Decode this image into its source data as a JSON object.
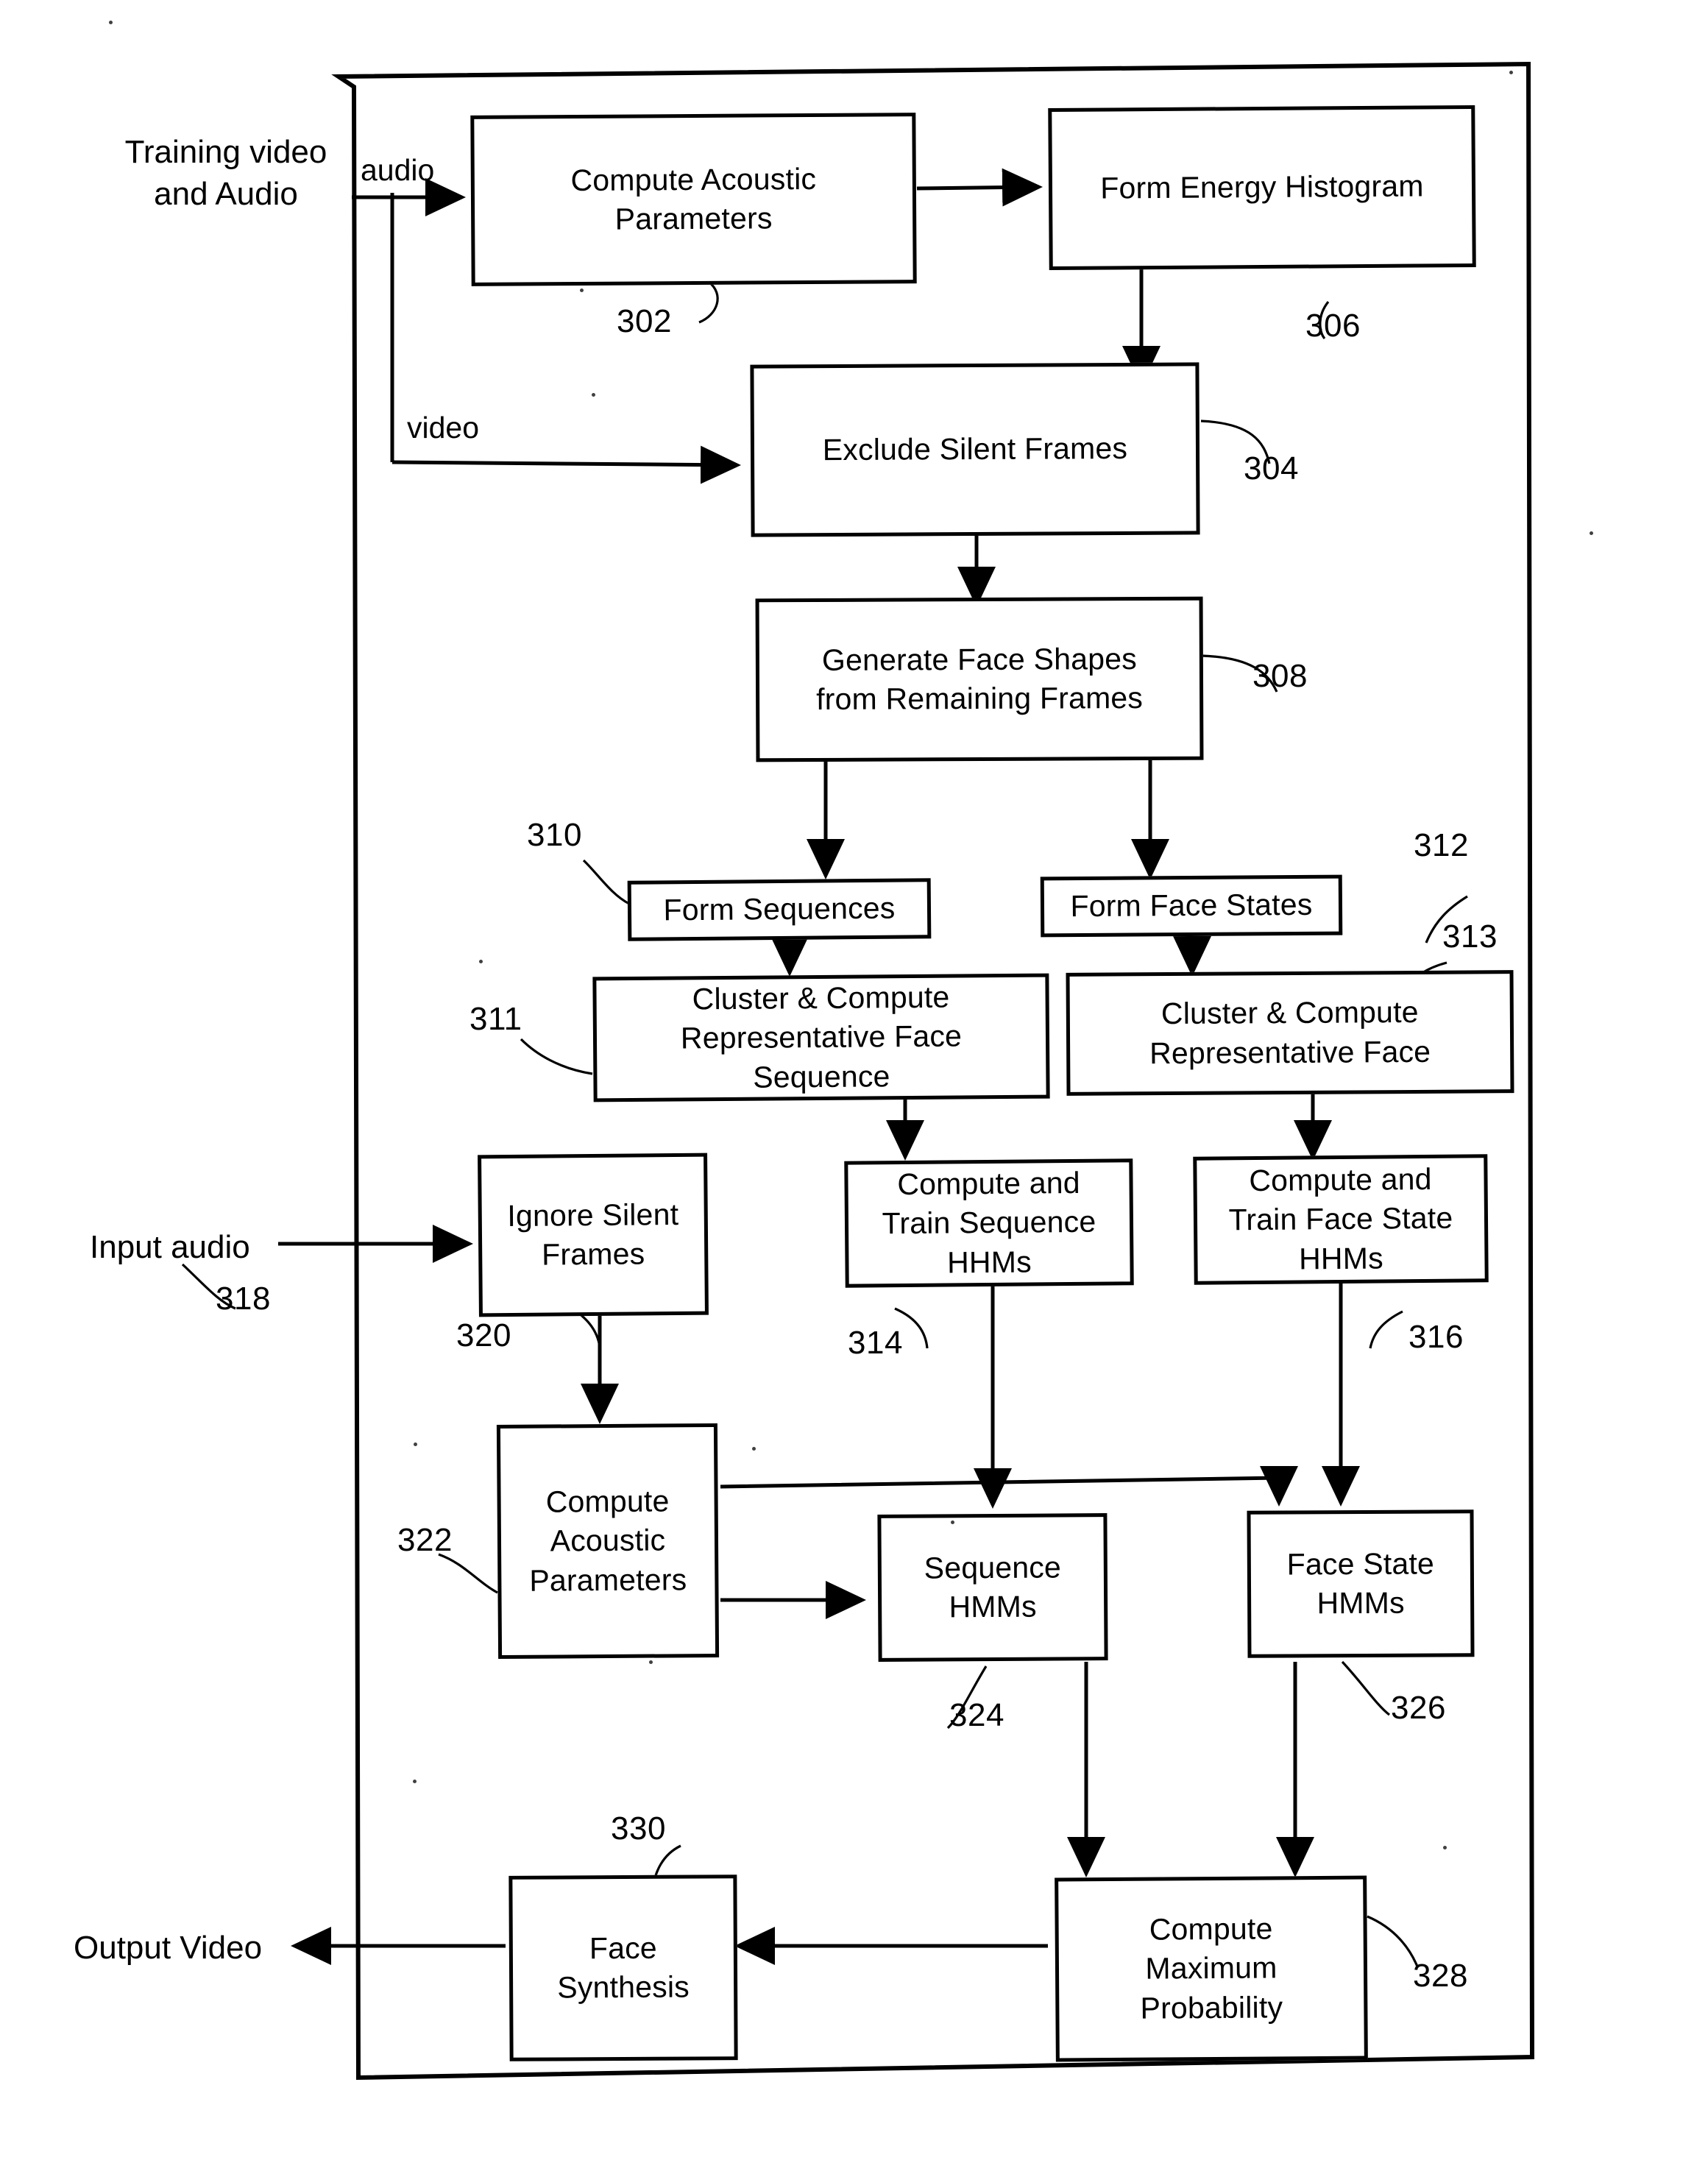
{
  "figure": {
    "kind": "patent-flowchart",
    "outer_frame": {
      "name": "diagram-border"
    }
  },
  "external_labels": [
    {
      "id": "training-input",
      "text": "Training video\nand Audio",
      "line1": "Training video",
      "line2": "and Audio"
    },
    {
      "id": "input-audio",
      "text": "Input audio"
    },
    {
      "id": "output-video",
      "text": "Output Video"
    }
  ],
  "edge_labels": [
    {
      "id": "audio",
      "text": "audio"
    },
    {
      "id": "video",
      "text": "video"
    }
  ],
  "nodes": [
    {
      "id": "compute-acoustic-parameters-train",
      "ref": "302",
      "lines": [
        "Compute Acoustic",
        "Parameters"
      ]
    },
    {
      "id": "form-energy-histogram",
      "ref": "306",
      "lines": [
        "Form Energy Histogram"
      ]
    },
    {
      "id": "exclude-silent-frames",
      "ref": "304",
      "lines": [
        "Exclude Silent Frames"
      ]
    },
    {
      "id": "generate-face-shapes",
      "ref": "308",
      "lines": [
        "Generate Face Shapes",
        "from Remaining Frames"
      ]
    },
    {
      "id": "form-sequences",
      "ref": "310",
      "lines": [
        "Form Sequences"
      ]
    },
    {
      "id": "form-face-states",
      "ref": "312",
      "lines": [
        "Form Face States"
      ]
    },
    {
      "id": "cluster-compute-rep-face-sequence",
      "ref": "311",
      "lines": [
        "Cluster & Compute",
        "Representative Face",
        "Sequence"
      ]
    },
    {
      "id": "cluster-compute-rep-face",
      "ref": "313",
      "lines": [
        "Cluster & Compute",
        "Representative Face"
      ]
    },
    {
      "id": "ignore-silent-frames",
      "ref": "320",
      "lines": [
        "Ignore Silent",
        "Frames"
      ]
    },
    {
      "id": "compute-train-sequence-hhms",
      "ref": "314",
      "lines": [
        "Compute  and",
        "Train Sequence",
        "HHMs"
      ]
    },
    {
      "id": "compute-train-face-state-hhms",
      "ref": "316",
      "lines": [
        "Compute and",
        "Train Face State",
        "HHMs"
      ]
    },
    {
      "id": "compute-acoustic-parameters-input",
      "ref": "322",
      "lines": [
        "Compute",
        "Acoustic",
        "Parameters"
      ]
    },
    {
      "id": "sequence-hmms",
      "ref": "324",
      "lines": [
        "Sequence",
        "HMMs"
      ]
    },
    {
      "id": "face-state-hmms",
      "ref": "326",
      "lines": [
        "Face State",
        "HMMs"
      ]
    },
    {
      "id": "compute-maximum-probability",
      "ref": "328",
      "lines": [
        "Compute",
        "Maximum",
        "Probability"
      ]
    },
    {
      "id": "face-synthesis",
      "ref": "330",
      "lines": [
        "Face",
        "Synthesis"
      ]
    }
  ],
  "reference_numerals": [
    "302",
    "304",
    "306",
    "308",
    "310",
    "311",
    "312",
    "313",
    "314",
    "316",
    "318",
    "320",
    "322",
    "324",
    "326",
    "328",
    "330"
  ],
  "colors": {
    "ink": "#000000",
    "paper": "#ffffff"
  }
}
